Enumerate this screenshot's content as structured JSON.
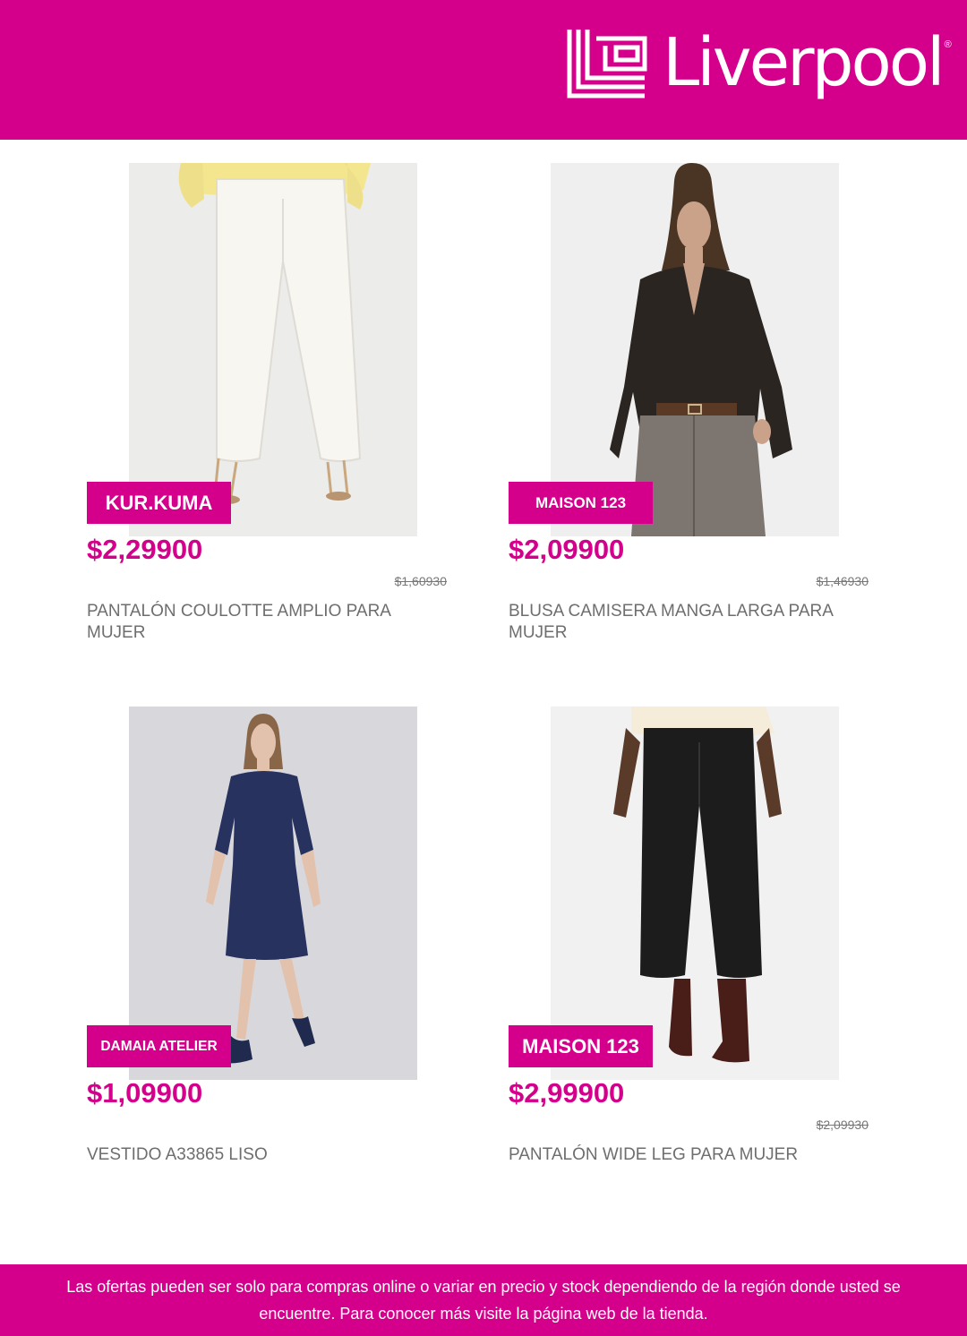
{
  "header": {
    "logo_text": "Liverpool",
    "logo_registered": "®",
    "brand_color": "#d4008c"
  },
  "products": [
    {
      "brand": "KUR.KUMA",
      "price": "$2,29900",
      "old_price": "$1,60930",
      "name": "PANTALÓN COULOTTE AMPLIO PARA MUJER",
      "image_icon": "white-wide-pants-photo"
    },
    {
      "brand": "MAISON 123",
      "price": "$2,09900",
      "old_price": "$1,46930",
      "name": "BLUSA CAMISERA MANGA LARGA PARA MUJER",
      "image_icon": "black-satin-blouse-photo"
    },
    {
      "brand": "DAMAIA ATELIER",
      "price": "$1,09900",
      "old_price": "",
      "name": "VESTIDO A33865 LISO",
      "image_icon": "navy-dress-photo"
    },
    {
      "brand": "MAISON 123",
      "price": "$2,99900",
      "old_price": "$2,09930",
      "name": "PANTALÓN WIDE LEG PARA MUJER",
      "image_icon": "black-wide-leg-pants-photo"
    }
  ],
  "footer": {
    "disclaimer": "Las ofertas pueden ser solo para compras online o variar en precio y stock dependiendo de la región donde usted se encuentre. Para conocer más visite la página web de la tienda."
  }
}
